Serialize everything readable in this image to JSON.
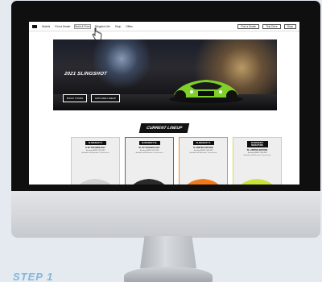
{
  "nav": {
    "items": [
      "Models",
      "Find a Dealer",
      "Build & Price",
      "Slingshot Life",
      "Shop",
      "Offers"
    ],
    "hover_index": 2,
    "right": [
      "Find a Dealer",
      "Test Drive",
      "Shop"
    ]
  },
  "hero": {
    "title": "2021 SLINGSHOT",
    "buttons": [
      "BUILD YOURS",
      "EXPLORE LINEUP"
    ]
  },
  "lineup": {
    "title": "CURRENT LINEUP",
    "cards": [
      {
        "badge": "SLINGSHOT S",
        "model": "S W/ TECHNOLOGY",
        "price": "Starting MSRP: $21,499",
        "feat": "Available with Automatic Transmission",
        "car_color": "#d0d0d0"
      },
      {
        "badge": "SLINGSHOT SL",
        "model": "SL W/ TECHNOLOGY",
        "price": "Starting MSRP: $27,999",
        "feat": "Available with Automatic Transmission",
        "car_color": "#2a2a2a"
      },
      {
        "badge": "SLINGSHOT R",
        "model": "R LIMITED EDITION",
        "price": "Starting MSRP: $32,999",
        "feat": "Available with Automatic Transmission",
        "car_color": "#f07a1a"
      },
      {
        "badge": "SLINGSHOT SIGNATURE",
        "model": "SL LIMITED EDITION",
        "price": "Starting MSRP: $29,999",
        "feat": "Available with Automatic Transmission",
        "car_color": "#cbe23a"
      }
    ]
  },
  "caption": "STEP 1"
}
